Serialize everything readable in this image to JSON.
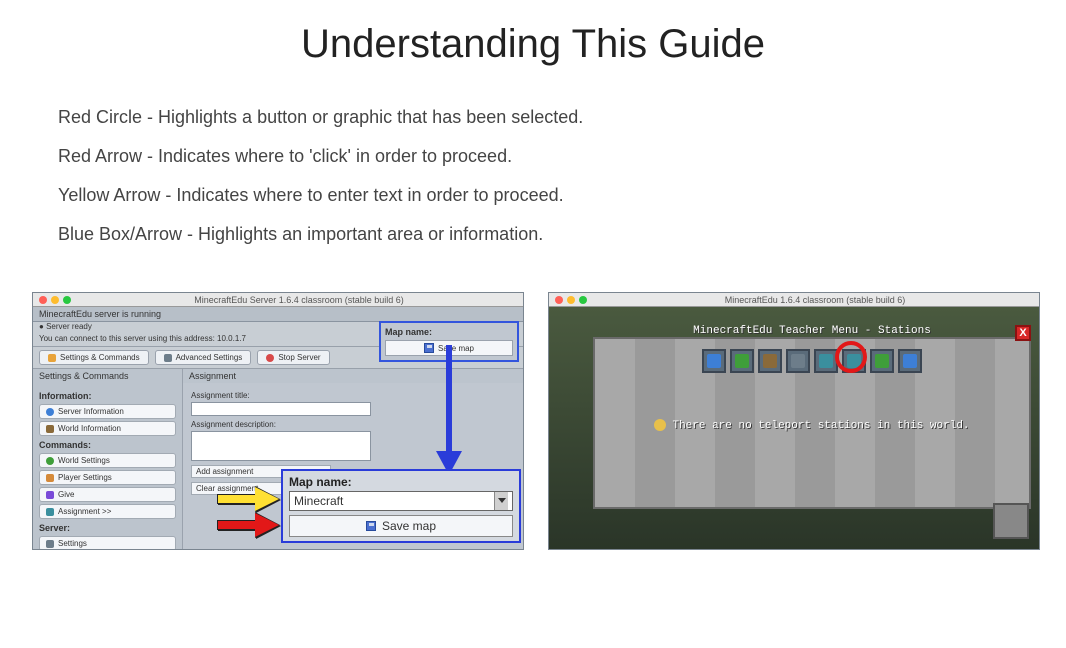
{
  "title": "Understanding This Guide",
  "legend": {
    "red_circle": "Red Circle - Highlights a button or graphic that has been selected.",
    "red_arrow": "Red Arrow - Indicates where to 'click' in order to proceed.",
    "yellow_arrow": "Yellow Arrow - Indicates where to enter text in order to proceed.",
    "blue_box": "Blue Box/Arrow - Highlights an important area or information."
  },
  "left": {
    "window_title": "MinecraftEdu Server 1.6.4 classroom (stable build 6)",
    "status": "MinecraftEdu server is running",
    "ready": "Server ready",
    "connect": "You can connect to this server using this address: 10.0.1.7",
    "btn_settings_cmds": "Settings & Commands",
    "btn_adv": "Advanced Settings",
    "btn_stop": "Stop Server",
    "sec_sc": "Settings & Commands",
    "sec_assign": "Assignment",
    "side": {
      "info_hdr": "Information:",
      "server_info": "Server Information",
      "world_info": "World Information",
      "cmds_hdr": "Commands:",
      "world_settings": "World Settings",
      "player_settings": "Player Settings",
      "give": "Give",
      "assignment": "Assignment >>",
      "server_hdr": "Server:",
      "settings": "Settings"
    },
    "assign": {
      "title_lbl": "Assignment title:",
      "desc_lbl": "Assignment description:",
      "add": "Add assignment",
      "clear": "Clear assignment"
    },
    "mapname_label": "Map name:",
    "save_map": "Save map",
    "zoom": {
      "label": "Map name:",
      "value": "Minecraft",
      "save": "Save map"
    }
  },
  "right": {
    "window_title": "MinecraftEdu 1.6.4 classroom (stable build 6)",
    "dialog_title": "MinecraftEdu Teacher Menu - Stations",
    "close": "X",
    "message": "There are no teleport stations in this world."
  }
}
